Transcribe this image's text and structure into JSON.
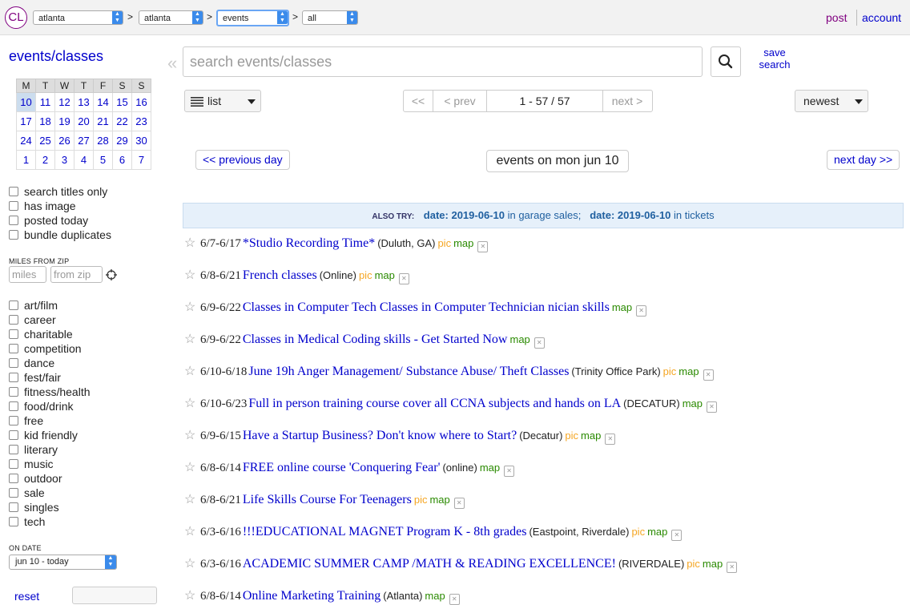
{
  "header": {
    "logo_text": "CL",
    "crumbs": [
      "atlanta",
      "atlanta",
      "events",
      "all"
    ],
    "separator": ">",
    "post": "post",
    "account": "account"
  },
  "sidebar": {
    "category_title": "events/classes",
    "calendar": {
      "weekdays": [
        "M",
        "T",
        "W",
        "T",
        "F",
        "S",
        "S"
      ],
      "weeks": [
        [
          "10",
          "11",
          "12",
          "13",
          "14",
          "15",
          "16"
        ],
        [
          "17",
          "18",
          "19",
          "20",
          "21",
          "22",
          "23"
        ],
        [
          "24",
          "25",
          "26",
          "27",
          "28",
          "29",
          "30"
        ],
        [
          "1",
          "2",
          "3",
          "4",
          "5",
          "6",
          "7"
        ]
      ],
      "today": "10"
    },
    "filters": [
      "search titles only",
      "has image",
      "posted today",
      "bundle duplicates"
    ],
    "miles_label": "MILES FROM ZIP",
    "miles_placeholder": "miles",
    "zip_placeholder": "from zip",
    "event_types": [
      "art/film",
      "career",
      "charitable",
      "competition",
      "dance",
      "fest/fair",
      "fitness/health",
      "food/drink",
      "free",
      "kid friendly",
      "literary",
      "music",
      "outdoor",
      "sale",
      "singles",
      "tech"
    ],
    "on_date_label": "ON DATE",
    "on_date_value": "jun 10 - today",
    "reset": "reset"
  },
  "search": {
    "placeholder": "search events/classes",
    "save_line1": "save",
    "save_line2": "search",
    "collapse": "«"
  },
  "toolbar": {
    "view": "list",
    "first": "<<",
    "prev": "< prev",
    "range": "1 - 57 / 57",
    "next": "next >",
    "sort": "newest"
  },
  "daynav": {
    "prev": "<< previous day",
    "title": "events on mon jun 10",
    "next": "next day >>"
  },
  "also_try": {
    "label": "ALSO TRY:",
    "date1_prefix": "date:",
    "date1": "2019-06-10",
    "in1": "in garage sales;",
    "date2_prefix": "date:",
    "date2": "2019-06-10",
    "in2": "in tickets"
  },
  "listings": [
    {
      "dates": "6/7-6/17",
      "title": "*Studio Recording Time*",
      "location": "(Duluth, GA)",
      "pic": "pic",
      "map": "map"
    },
    {
      "dates": "6/8-6/21",
      "title": "French classes",
      "location": "(Online)",
      "pic": "pic",
      "map": "map"
    },
    {
      "dates": "6/9-6/22",
      "title": "Classes in Computer Tech Classes in Computer Technician nician skills",
      "location": "",
      "pic": "",
      "map": "map"
    },
    {
      "dates": "6/9-6/22",
      "title": "Classes in Medical Coding skills - Get Started Now",
      "location": "",
      "pic": "",
      "map": "map"
    },
    {
      "dates": "6/10-6/18",
      "title": "June 19h Anger Management/ Substance Abuse/ Theft Classes",
      "location": "(Trinity Office Park)",
      "pic": "pic",
      "map": "map"
    },
    {
      "dates": "6/10-6/23",
      "title": "Full in person training course cover all CCNA subjects and hands on LA",
      "location": "(DECATUR)",
      "pic": "",
      "map": "map"
    },
    {
      "dates": "6/9-6/15",
      "title": "Have a Startup Business? Don't know where to Start?",
      "location": "(Decatur)",
      "pic": "pic",
      "map": "map"
    },
    {
      "dates": "6/8-6/14",
      "title": "FREE online course 'Conquering Fear'",
      "location": "(online)",
      "pic": "",
      "map": "map"
    },
    {
      "dates": "6/8-6/21",
      "title": "Life Skills Course For Teenagers",
      "location": "",
      "pic": "pic",
      "map": "map"
    },
    {
      "dates": "6/3-6/16",
      "title": "!!!EDUCATIONAL MAGNET Program K - 8th grades",
      "location": "(Eastpoint, Riverdale)",
      "pic": "pic",
      "map": "map"
    },
    {
      "dates": "6/3-6/16",
      "title": "ACADEMIC SUMMER CAMP /MATH & READING EXCELLENCE!",
      "location": "(RIVERDALE)",
      "pic": "pic",
      "map": "map"
    },
    {
      "dates": "6/8-6/14",
      "title": "Online Marketing Training",
      "location": "(Atlanta)",
      "pic": "",
      "map": "map"
    }
  ]
}
